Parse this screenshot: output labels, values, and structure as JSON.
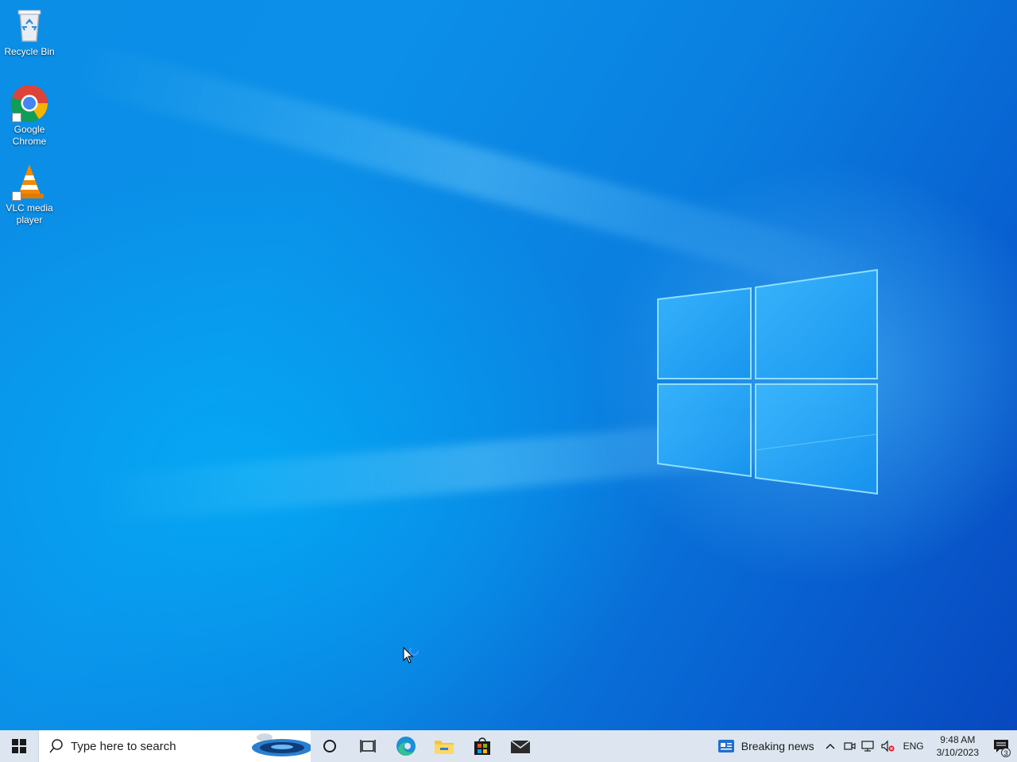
{
  "desktop": {
    "icons": [
      {
        "label": "Recycle Bin",
        "icon": "recycle-bin-icon"
      },
      {
        "label": "Google Chrome",
        "icon": "chrome-icon"
      },
      {
        "label": "VLC media player",
        "icon": "vlc-icon"
      }
    ]
  },
  "taskbar": {
    "search_placeholder": "Type here to search",
    "pinned": [
      {
        "name": "cortana",
        "icon": "circle-icon"
      },
      {
        "name": "task-view",
        "icon": "task-view-icon"
      },
      {
        "name": "microsoft-edge",
        "icon": "edge-icon"
      },
      {
        "name": "file-explorer",
        "icon": "folder-icon"
      },
      {
        "name": "microsoft-store",
        "icon": "store-icon"
      },
      {
        "name": "mail",
        "icon": "mail-icon"
      }
    ],
    "news_label": "Breaking news",
    "language": "ENG",
    "time": "9:48 AM",
    "date": "3/10/2023",
    "notification_count": "3"
  },
  "colors": {
    "taskbar_bg": "#dde6f0",
    "desktop_accent": "#0a8ee6"
  }
}
